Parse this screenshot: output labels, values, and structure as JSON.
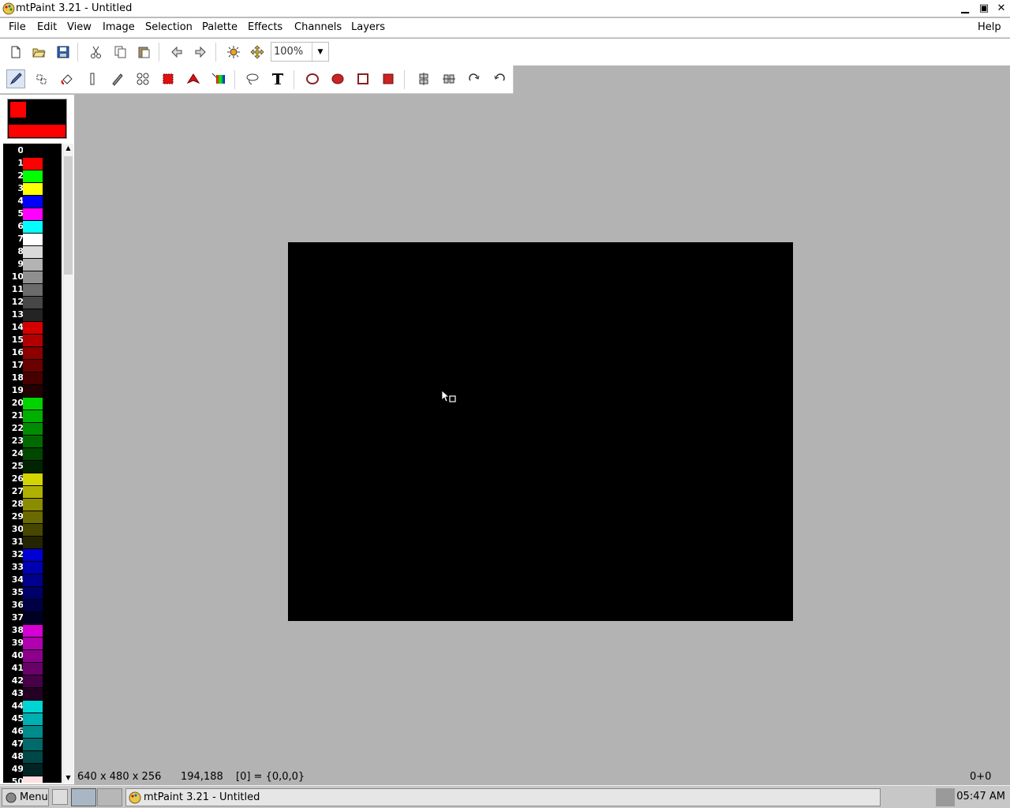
{
  "window": {
    "title": "mtPaint 3.21 - Untitled",
    "minimize": "▁",
    "restore": "▣",
    "close": "✕"
  },
  "menu": {
    "file": "File",
    "edit": "Edit",
    "view": "View",
    "image": "Image",
    "selection": "Selection",
    "palette": "Palette",
    "effects": "Effects",
    "channels": "Channels",
    "layers": "Layers",
    "help": "Help"
  },
  "toolbar": {
    "zoom": "100%"
  },
  "colors": {
    "foreground": "#ff0000",
    "background": "#000000"
  },
  "palette": [
    {
      "n": "0",
      "c": "#000000"
    },
    {
      "n": "1",
      "c": "#ff0000"
    },
    {
      "n": "2",
      "c": "#00ff00"
    },
    {
      "n": "3",
      "c": "#ffff00"
    },
    {
      "n": "4",
      "c": "#0000ff"
    },
    {
      "n": "5",
      "c": "#ff00ff"
    },
    {
      "n": "6",
      "c": "#00ffff"
    },
    {
      "n": "7",
      "c": "#ffffff"
    },
    {
      "n": "8",
      "c": "#d9d9d9"
    },
    {
      "n": "9",
      "c": "#b3b3b3"
    },
    {
      "n": "10",
      "c": "#8f8f8f"
    },
    {
      "n": "11",
      "c": "#6b6b6b"
    },
    {
      "n": "12",
      "c": "#474747"
    },
    {
      "n": "13",
      "c": "#242424"
    },
    {
      "n": "14",
      "c": "#d40000"
    },
    {
      "n": "15",
      "c": "#b00000"
    },
    {
      "n": "16",
      "c": "#8c0000"
    },
    {
      "n": "17",
      "c": "#6a0000"
    },
    {
      "n": "18",
      "c": "#470000"
    },
    {
      "n": "19",
      "c": "#240000"
    },
    {
      "n": "20",
      "c": "#00d400"
    },
    {
      "n": "21",
      "c": "#00b000"
    },
    {
      "n": "22",
      "c": "#008c00"
    },
    {
      "n": "23",
      "c": "#006a00"
    },
    {
      "n": "24",
      "c": "#004700"
    },
    {
      "n": "25",
      "c": "#002400"
    },
    {
      "n": "26",
      "c": "#d4d400"
    },
    {
      "n": "27",
      "c": "#b0b000"
    },
    {
      "n": "28",
      "c": "#8c8c00"
    },
    {
      "n": "29",
      "c": "#6a6a00"
    },
    {
      "n": "30",
      "c": "#474700"
    },
    {
      "n": "31",
      "c": "#242400"
    },
    {
      "n": "32",
      "c": "#0000d4"
    },
    {
      "n": "33",
      "c": "#0000b0"
    },
    {
      "n": "34",
      "c": "#00008c"
    },
    {
      "n": "35",
      "c": "#00006a"
    },
    {
      "n": "36",
      "c": "#000047"
    },
    {
      "n": "37",
      "c": "#000024"
    },
    {
      "n": "38",
      "c": "#d400d4"
    },
    {
      "n": "39",
      "c": "#b000b0"
    },
    {
      "n": "40",
      "c": "#8c008c"
    },
    {
      "n": "41",
      "c": "#6a006a"
    },
    {
      "n": "42",
      "c": "#470047"
    },
    {
      "n": "43",
      "c": "#240024"
    },
    {
      "n": "44",
      "c": "#00d4d4"
    },
    {
      "n": "45",
      "c": "#00b0b0"
    },
    {
      "n": "46",
      "c": "#008c8c"
    },
    {
      "n": "47",
      "c": "#006a6a"
    },
    {
      "n": "48",
      "c": "#004747"
    },
    {
      "n": "49",
      "c": "#002424"
    },
    {
      "n": "50",
      "c": "#ffe0e0"
    }
  ],
  "status": {
    "geometry": "640 x 480 x 256",
    "cursor": "194,188",
    "pixel": "[0] = {0,0,0}",
    "selection": "0+0"
  },
  "taskbar": {
    "menu": "Menu",
    "task": "mtPaint 3.21 - Untitled",
    "clock": "05:47 AM"
  }
}
